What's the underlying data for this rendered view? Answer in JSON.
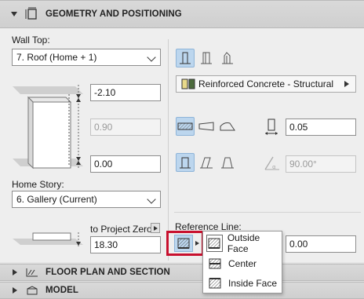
{
  "sections": {
    "geometry": "GEOMETRY AND POSITIONING",
    "floorplan": "FLOOR PLAN AND SECTION",
    "model": "MODEL"
  },
  "left": {
    "wall_top_label": "Wall Top:",
    "wall_top_value": "7. Roof (Home + 1)",
    "top_offset": "-2.10",
    "height": "0.90",
    "bottom_offset": "0.00",
    "home_story_label": "Home Story:",
    "home_story_value": "6. Gallery (Current)",
    "to_project_zero_label": "to Project Zero",
    "project_zero_value": "18.30"
  },
  "right": {
    "material": "Reinforced Concrete - Structural",
    "thickness": "0.05",
    "slant_angle": "90.00°",
    "reference_line_label": "Reference Line:",
    "reference_offset": "0.00"
  },
  "popup": {
    "items": [
      "Outside Face",
      "Center",
      "Inside Face"
    ]
  },
  "colors": {
    "selected_bg": "#bcd6ee",
    "highlight": "#c8102e"
  }
}
